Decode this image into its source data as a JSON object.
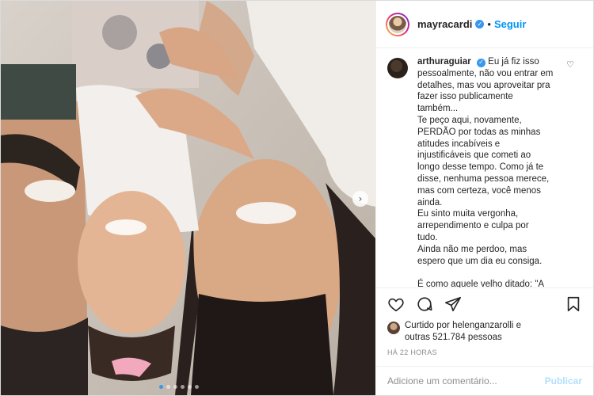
{
  "post": {
    "username": "mayracardi",
    "separator": "•",
    "follow_label": "Seguir"
  },
  "comment": {
    "username": "arthuraguiar",
    "lines": [
      "Eu já fiz isso",
      "pessoalmente, não vou entrar em",
      "detalhes, mas vou aproveitar pra",
      "fazer isso publicamente",
      "também...",
      "Te peço aqui, novamente,",
      "PERDÃO por todas as minhas",
      "atitudes incabíveis e",
      "injustificáveis que cometi ao",
      "longo desse tempo. Como já te",
      "disse, nenhuma pessoa merece,",
      "mas com certeza, você menos",
      "ainda.",
      "Eu sinto muita vergonha,",
      "arrependimento e culpa por",
      "tudo.",
      "Ainda não me perdoo, mas",
      "espero que um dia eu consiga.",
      "",
      "É como aquele velho ditado: \"A"
    ]
  },
  "likes": {
    "line1": "Curtido por helenganzarolli e",
    "line2": "outras 521.784 pessoas"
  },
  "timestamp": "HÁ 22 HORAS",
  "add_comment": {
    "placeholder": "Adicione um comentário...",
    "publish_label": "Publicar"
  },
  "icons": {
    "like": "heart-icon",
    "comment": "comment-icon",
    "share": "share-icon",
    "save": "bookmark-icon",
    "verified": "verified-badge-icon",
    "next": "chevron-right-icon"
  },
  "colors": {
    "accent": "#0095f6",
    "verified": "#3897f0",
    "publish_disabled": "#b2dffc"
  }
}
